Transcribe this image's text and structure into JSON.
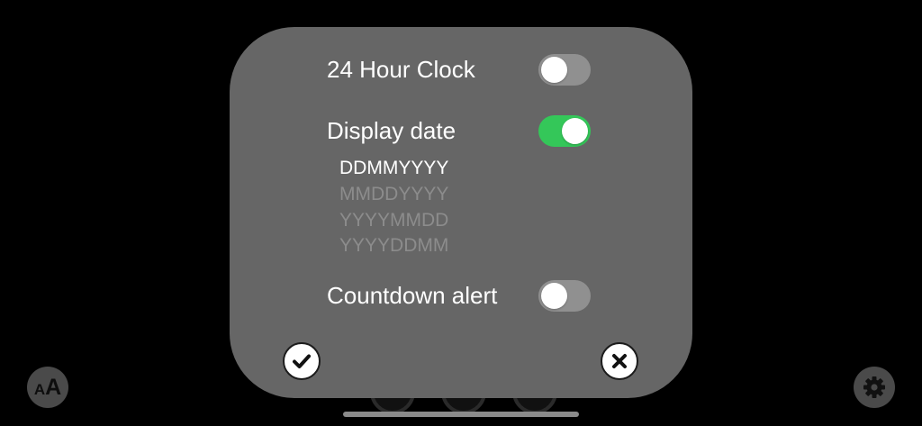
{
  "settings": {
    "clock24": {
      "label": "24 Hour Clock",
      "enabled": false
    },
    "display_date": {
      "label": "Display date",
      "enabled": true
    },
    "date_formats": [
      {
        "label": "DDMMYYYY",
        "selected": true
      },
      {
        "label": "MMDDYYYY",
        "selected": false
      },
      {
        "label": "YYYYMMDD",
        "selected": false
      },
      {
        "label": "YYYYDDMM",
        "selected": false
      }
    ],
    "countdown_alert": {
      "label": "Countdown alert",
      "enabled": false
    }
  },
  "actions": {
    "confirm_icon": "checkmark-icon",
    "cancel_icon": "close-icon"
  },
  "corner": {
    "font_size_icon": "text-size-icon",
    "font_size_small": "A",
    "font_size_big": "A",
    "settings_icon": "gear-icon"
  },
  "colors": {
    "panel": "#666666",
    "toggle_on": "#34c759",
    "toggle_off": "#909090",
    "unselected_text": "#8c8c8c"
  }
}
